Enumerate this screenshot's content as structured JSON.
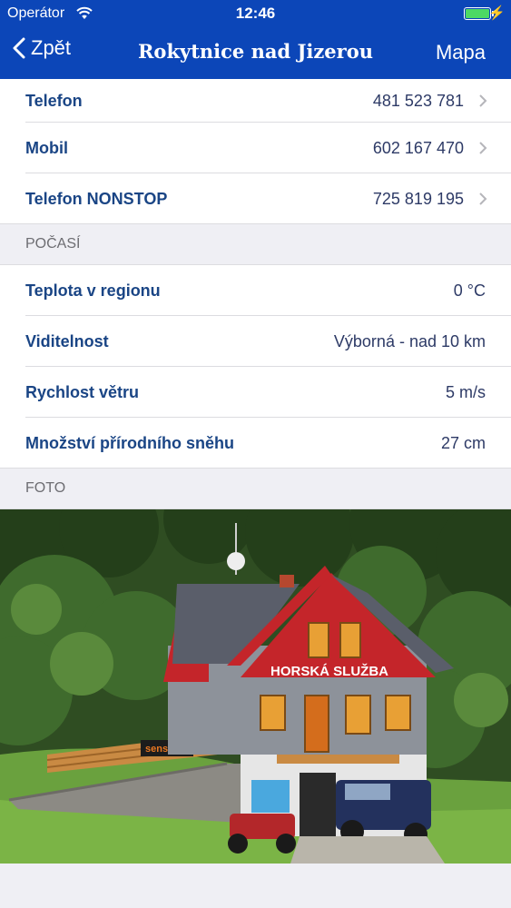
{
  "status_bar": {
    "carrier": "Operátor",
    "time": "12:46"
  },
  "nav": {
    "back_label": "Zpět",
    "title": "Rokytnice nad Jizerou",
    "map_label": "Mapa"
  },
  "contacts": [
    {
      "label": "Telefon",
      "value": "481 523 781"
    },
    {
      "label": "Mobil",
      "value": "602 167 470"
    },
    {
      "label": "Telefon NONSTOP",
      "value": "725 819 195"
    }
  ],
  "weather": {
    "header": "POČASÍ",
    "rows": [
      {
        "label": "Teplota v regionu",
        "value": "0 °C"
      },
      {
        "label": "Viditelnost",
        "value": "Výborná - nad 10 km"
      },
      {
        "label": "Rychlost větru",
        "value": "5 m/s"
      },
      {
        "label": "Množství přírodního sněhu",
        "value": "27 cm"
      }
    ]
  },
  "photo": {
    "header": "FOTO",
    "sign_text": "HORSKÁ SLUŽBA",
    "banner_text": "sensor"
  },
  "colors": {
    "nav": "#0c46b8",
    "label": "#1a4585",
    "roof": "#5a5e6a",
    "house_red": "#c4252a"
  },
  "icons": [
    "wifi-icon",
    "battery-icon",
    "charging-icon",
    "back-chevron-icon",
    "disclosure-chevron-icon"
  ]
}
